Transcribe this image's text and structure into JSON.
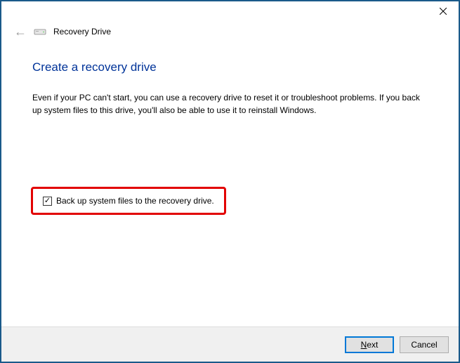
{
  "window": {
    "title": "Recovery Drive"
  },
  "page": {
    "heading": "Create a recovery drive",
    "description": "Even if your PC can't start, you can use a recovery drive to reset it or troubleshoot problems. If you back up system files to this drive, you'll also be able to use it to reinstall Windows."
  },
  "checkbox": {
    "label": "Back up system files to the recovery drive.",
    "checked": true
  },
  "buttons": {
    "next_prefix": "N",
    "next_suffix": "ext",
    "cancel": "Cancel"
  }
}
